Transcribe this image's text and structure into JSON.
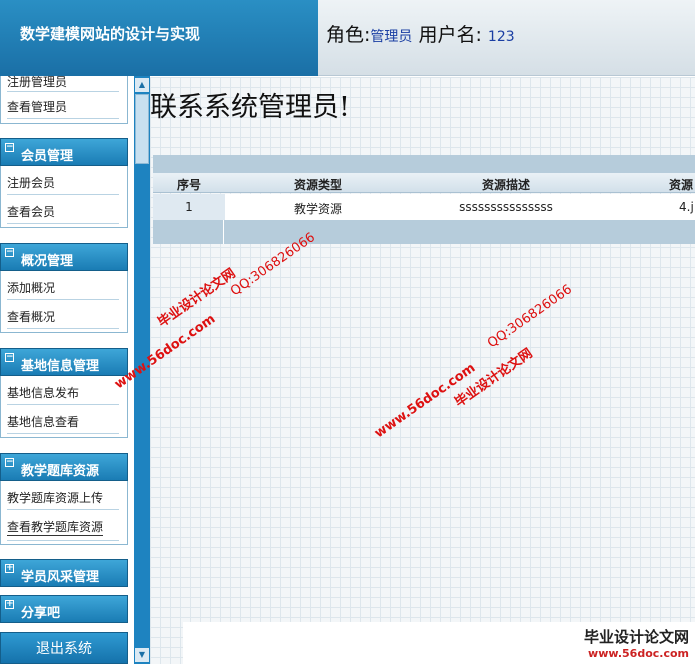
{
  "header": {
    "title": "数学建模网站的设计与实现",
    "role_label": "角色:",
    "role_value": "管理员",
    "user_label": "用户名:",
    "user_value": "123"
  },
  "sidebar": {
    "groups": [
      {
        "title": "",
        "items": [
          "注册管理员",
          "查看管理员"
        ]
      },
      {
        "title": "会员管理",
        "toggle": "−",
        "items": [
          "注册会员",
          "查看会员"
        ]
      },
      {
        "title": "概况管理",
        "toggle": "−",
        "items": [
          "添加概况",
          "查看概况"
        ]
      },
      {
        "title": "基地信息管理",
        "toggle": "−",
        "items": [
          "基地信息发布",
          "基地信息查看"
        ]
      },
      {
        "title": "教学题库资源",
        "toggle": "−",
        "items": [
          "教学题库资源上传",
          "查看教学题库资源"
        ]
      },
      {
        "title": "学员风采管理",
        "toggle": "+",
        "items": []
      },
      {
        "title": "分享吧",
        "toggle": "+",
        "items": []
      }
    ],
    "logout": "退出系统"
  },
  "scrollbar": {
    "up": "▲",
    "down": "▼"
  },
  "main": {
    "welcome": "联系系统管理员!",
    "table": {
      "headers": [
        "序号",
        "资源类型",
        "资源描述",
        "资源"
      ],
      "rows": [
        [
          "1",
          "教学资源",
          "sssssssssssssss",
          "4.j"
        ]
      ]
    }
  },
  "watermarks": {
    "site_name": "毕业设计论文网",
    "qq": "QQ:306826066",
    "url": "www.56doc.com",
    "footer_big": "毕业设计论文网",
    "footer_small": "www.56doc.com"
  }
}
